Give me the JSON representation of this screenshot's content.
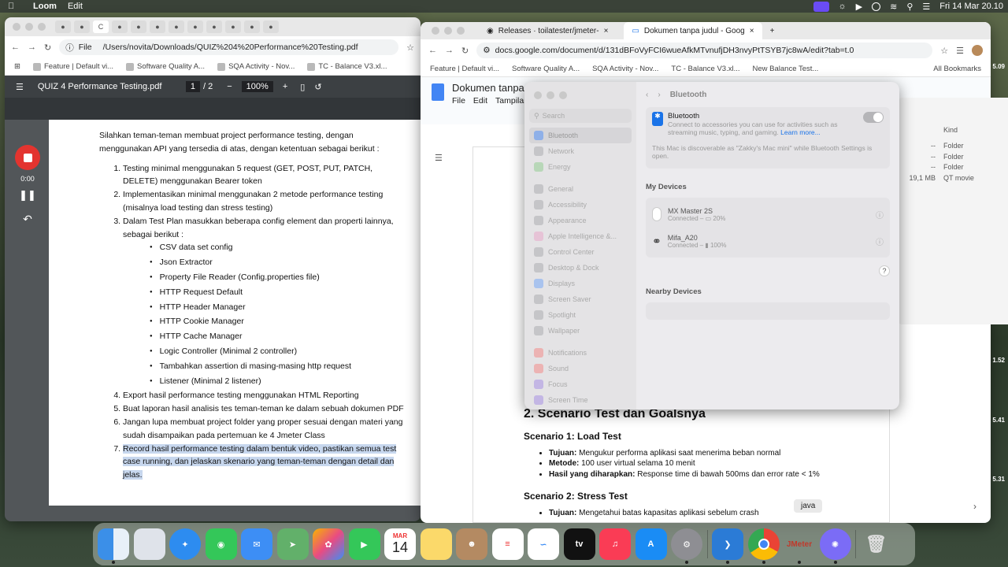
{
  "menubar": {
    "app": "Loom",
    "menu": [
      "Edit"
    ],
    "clock": "Fri 14 Mar  20.10"
  },
  "left_browser": {
    "url": "/Users/novita/Downloads/QUIZ%204%20Performance%20Testing.pdf",
    "url_prefix": "File",
    "bookmarks": [
      "Feature | Default vi...",
      "Software Quality A...",
      "SQA Activity - Nov...",
      "TC - Balance V3.xl..."
    ],
    "pdf_title": "QUIZ 4 Performance Testing.pdf",
    "page_current": "1",
    "page_total": "/ 2",
    "zoom": "100%"
  },
  "pdf": {
    "intro": "Silahkan teman-teman membuat project performance testing, dengan menggunakan API yang tersedia di atas, dengan ketentuan sebagai berikut :",
    "items": [
      "Testing minimal menggunakan 5 request (GET, POST, PUT, PATCH, DELETE) menggunakan Bearer token",
      "Implementasikan minimal menggunakan 2 metode performance testing (misalnya load testing dan stress testing)",
      "Dalam Test Plan masukkan beberapa config element dan properti lainnya, sebagai berikut :"
    ],
    "sub_items": [
      "CSV data set config",
      "Json Extractor",
      "Property File Reader (Config.properties file)",
      "HTTP Request Default",
      "HTTP Header Manager",
      "HTTP Cookie Manager",
      "HTTP Cache Manager",
      "Logic Controller (Minimal 2 controller)",
      "Tambahkan assertion di masing-masing http request",
      "Listener (Minimal 2 listener)"
    ],
    "items_after": [
      "Export hasil performance testing menggunakan HTML Reporting",
      "Buat laporan hasil analisis tes teman-teman ke dalam sebuah dokumen PDF",
      "Jangan lupa membuat project folder yang proper sesuai dengan materi yang sudah disampaikan pada pertemuan ke 4 Jmeter Class"
    ],
    "item7": "Record hasil performance testing dalam bentuk video, pastikan semua test case running, dan jelaskan skenario yang teman-teman dengan detail dan jelas."
  },
  "loom": {
    "time": "0:00"
  },
  "right_browser": {
    "tabs": [
      "Releases · toilatester/jmeter-",
      "Dokumen tanpa judul - Goog"
    ],
    "url": "docs.google.com/document/d/131dBFoVyFCI6wueAfkMTvnufjDH3nvyPtTSYB7jc8wA/edit?tab=t.0",
    "bookmarks": [
      "Feature | Default vi...",
      "Software Quality A...",
      "SQA Activity - Nov...",
      "TC - Balance V3.xl...",
      "New Balance Test..."
    ],
    "all_bookmarks": "All Bookmarks",
    "doc_title": "Dokumen tanpa j",
    "doc_menu": [
      "File",
      "Edit",
      "Tampilan"
    ]
  },
  "doc": {
    "heading": "2. Scenario Test dan Goalsnya",
    "s1_title": "Scenario 1: Load Test",
    "s1_tujuan_label": "Tujuan:",
    "s1_tujuan": " Mengukur performa aplikasi saat menerima beban normal",
    "s1_metode_label": "Metode:",
    "s1_metode": " 100 user virtual selama 10 menit",
    "s1_hasil_label": "Hasil yang diharapkan:",
    "s1_hasil": " Response time di bawah 500ms dan error rate < 1%",
    "s2_title": "Scenario 2: Stress Test",
    "s2_tujuan_label": "Tujuan:",
    "s2_tujuan": " Mengetahui batas kapasitas aplikasi sebelum crash"
  },
  "settings": {
    "title": "Bluetooth",
    "search_placeholder": "Search",
    "sidebar": [
      "Bluetooth",
      "Network",
      "Energy",
      "General",
      "Accessibility",
      "Appearance",
      "Apple Intelligence &...",
      "Control Center",
      "Desktop & Dock",
      "Displays",
      "Screen Saver",
      "Spotlight",
      "Wallpaper",
      "Notifications",
      "Sound",
      "Focus",
      "Screen Time"
    ],
    "bt_label": "Bluetooth",
    "bt_desc": "Connect to accessories you can use for activities such as streaming music, typing, and gaming.",
    "bt_learn": "Learn more...",
    "discoverable": "This Mac is discoverable as \"Zakky's Mac mini\" while Bluetooth Settings is open.",
    "my_devices": "My Devices",
    "devices": [
      {
        "name": "MX Master 2S",
        "status": "Connected –",
        "battery": "20%"
      },
      {
        "name": "Mifa_A20",
        "status": "Connected –",
        "battery": "100%"
      }
    ],
    "nearby": "Nearby Devices"
  },
  "finder": {
    "kind_header": "Kind",
    "rows": [
      {
        "size": "--",
        "kind": "Folder"
      },
      {
        "size": "--",
        "kind": "Folder"
      },
      {
        "size": "--",
        "kind": "Folder"
      },
      {
        "size": "19,1 MB",
        "kind": "QT movie"
      }
    ]
  },
  "side_numbers": [
    "5.09",
    "1.52",
    "5.41",
    "5.31"
  ],
  "dock": {
    "tooltip": "java",
    "calendar_month": "MAR",
    "calendar_day": "14",
    "apple_tv": "tv",
    "jmeter": "JMeter"
  },
  "colors": {
    "loom_red": "#e3342f",
    "highlight": "#c7d7ee",
    "bt_blue": "#1a73e8"
  }
}
